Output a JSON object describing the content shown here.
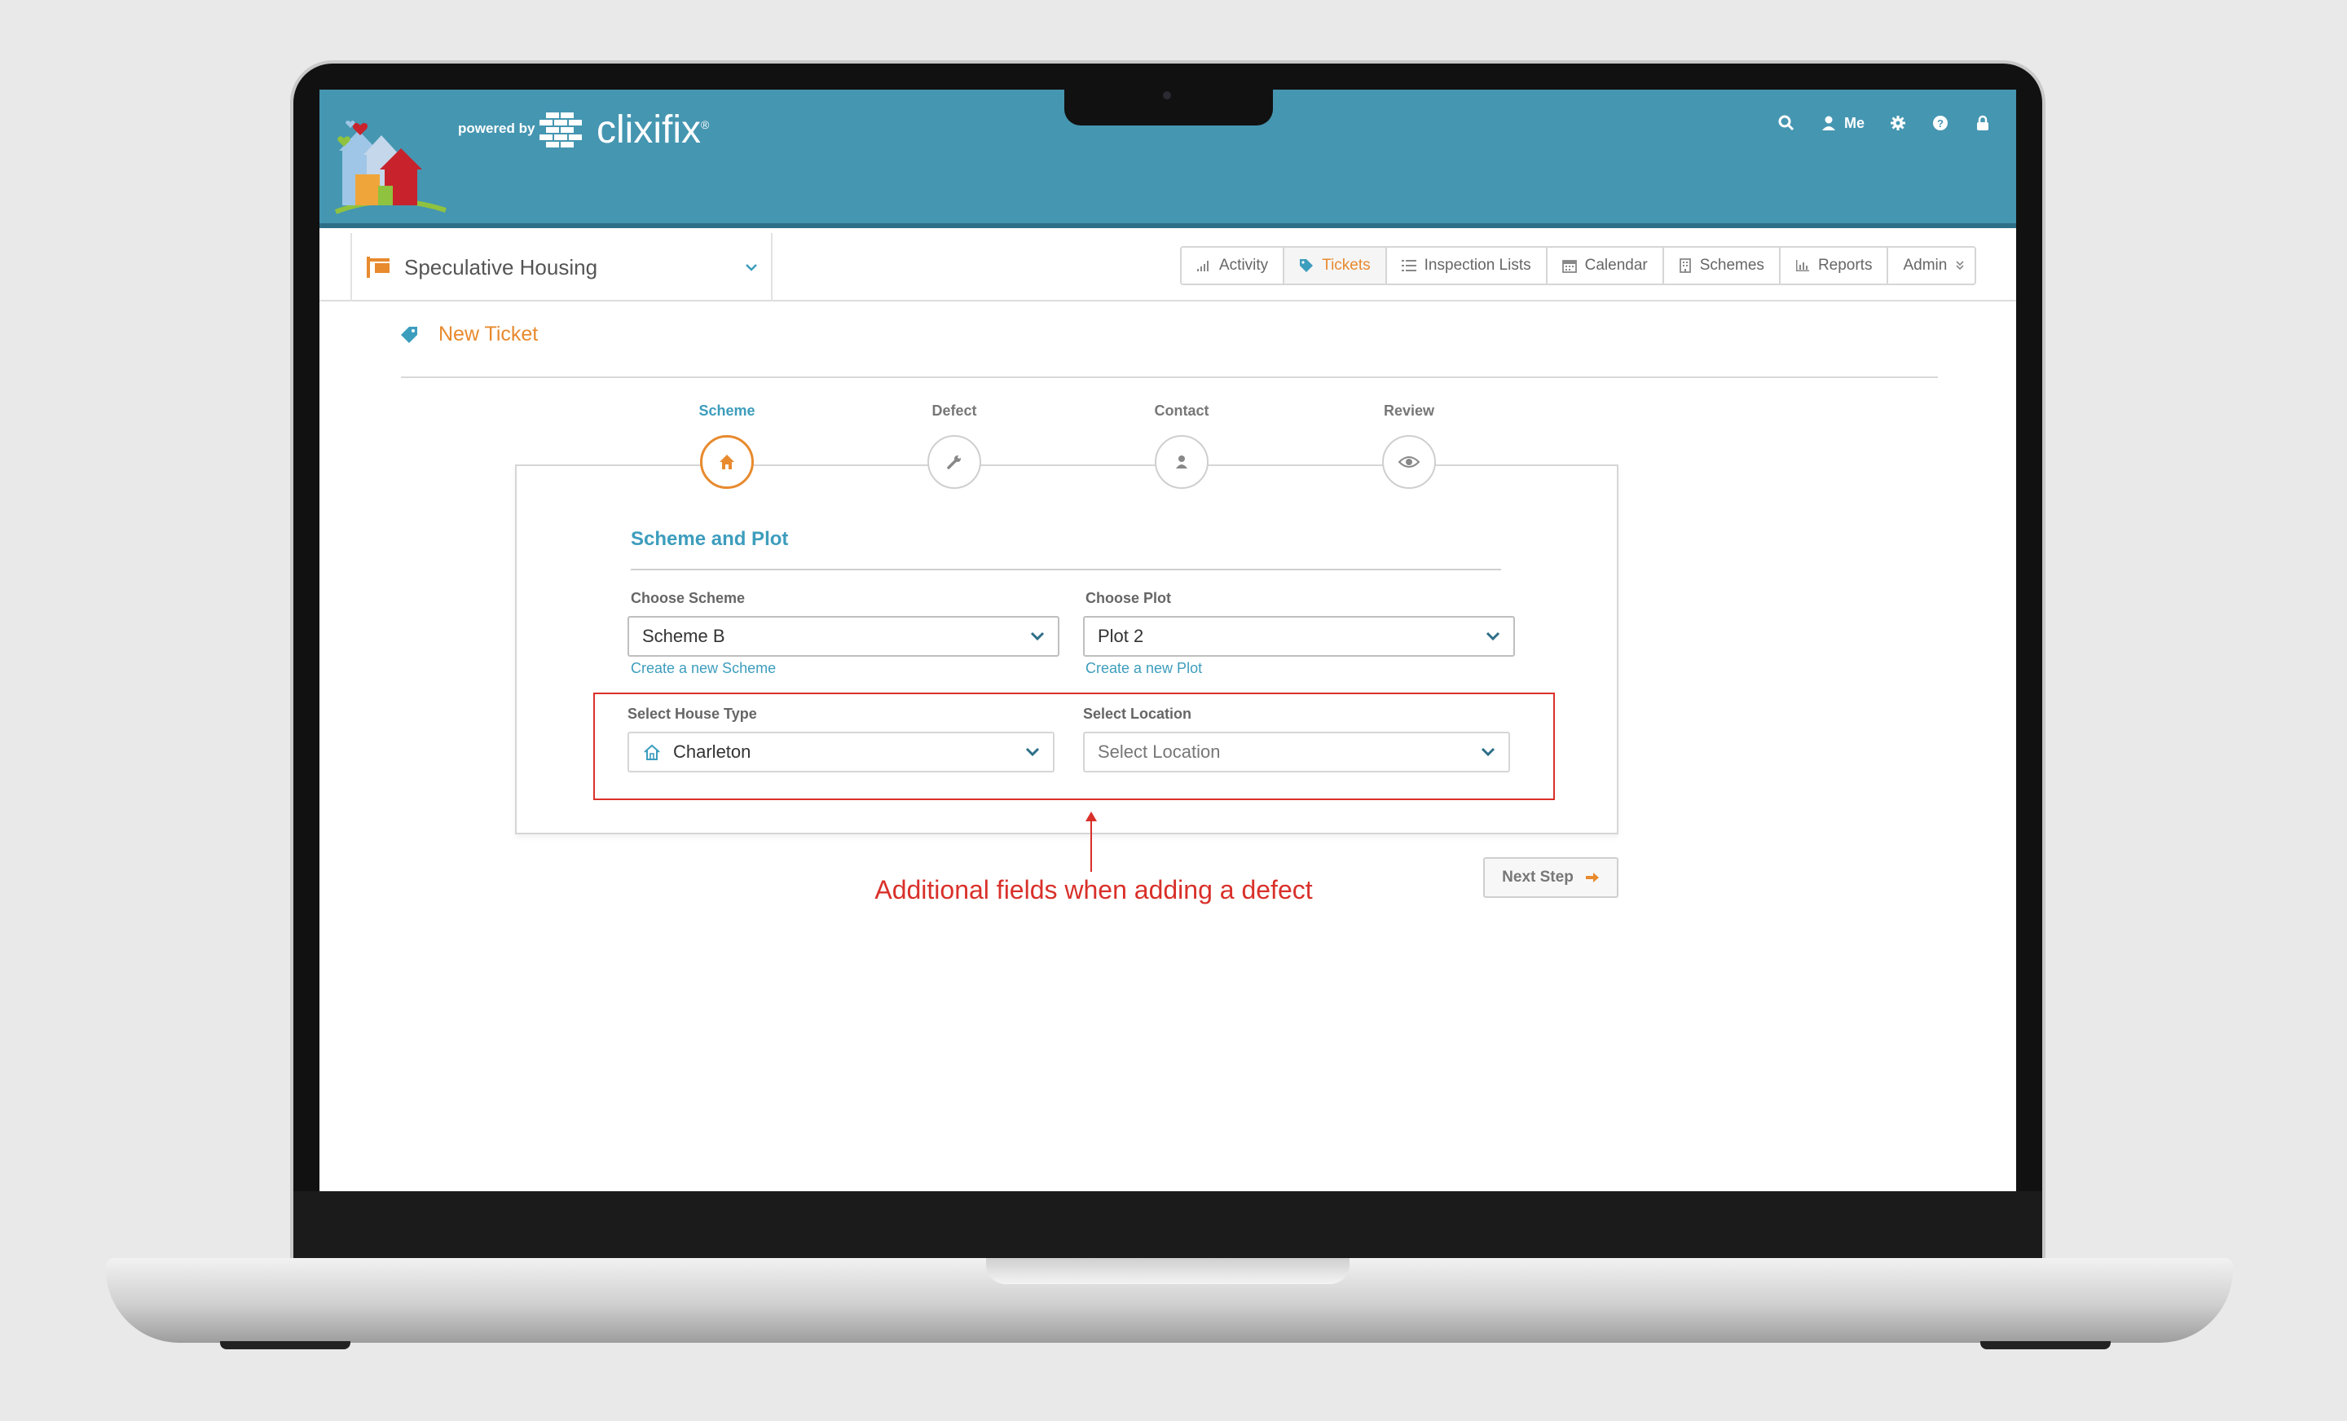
{
  "header": {
    "powered_by": "powered by",
    "brand": "clixifix",
    "brand_mark": "®",
    "nav": {
      "me_label": "Me"
    }
  },
  "subbar": {
    "project_name": "Speculative Housing",
    "tabs": [
      {
        "label": "Activity",
        "icon": "activity-icon"
      },
      {
        "label": "Tickets",
        "icon": "tag-icon",
        "active": true
      },
      {
        "label": "Inspection Lists",
        "icon": "list-icon"
      },
      {
        "label": "Calendar",
        "icon": "calendar-icon"
      },
      {
        "label": "Schemes",
        "icon": "building-icon"
      },
      {
        "label": "Reports",
        "icon": "bar-chart-icon"
      },
      {
        "label": "Admin",
        "icon": "double-chevron-icon"
      }
    ]
  },
  "page": {
    "title": "New Ticket"
  },
  "wizard": {
    "steps": [
      {
        "label": "Scheme",
        "icon": "home-icon",
        "active": true
      },
      {
        "label": "Defect",
        "icon": "wrench-icon"
      },
      {
        "label": "Contact",
        "icon": "user-icon"
      },
      {
        "label": "Review",
        "icon": "eye-icon"
      }
    ],
    "section_title": "Scheme and Plot",
    "choose_scheme": {
      "label": "Choose Scheme",
      "value": "Scheme B",
      "link": "Create a new Scheme"
    },
    "choose_plot": {
      "label": "Choose Plot",
      "value": "Plot 2",
      "link": "Create a new Plot"
    },
    "house_type": {
      "label": "Select House Type",
      "value": "Charleton"
    },
    "location": {
      "label": "Select Location",
      "placeholder": "Select Location"
    },
    "next_button": "Next Step"
  },
  "annotation": "Additional fields when adding a defect",
  "colors": {
    "header": "#4596b1",
    "accent": "#e88a2e",
    "link": "#3d9dbd",
    "annotation": "#d9302a"
  }
}
